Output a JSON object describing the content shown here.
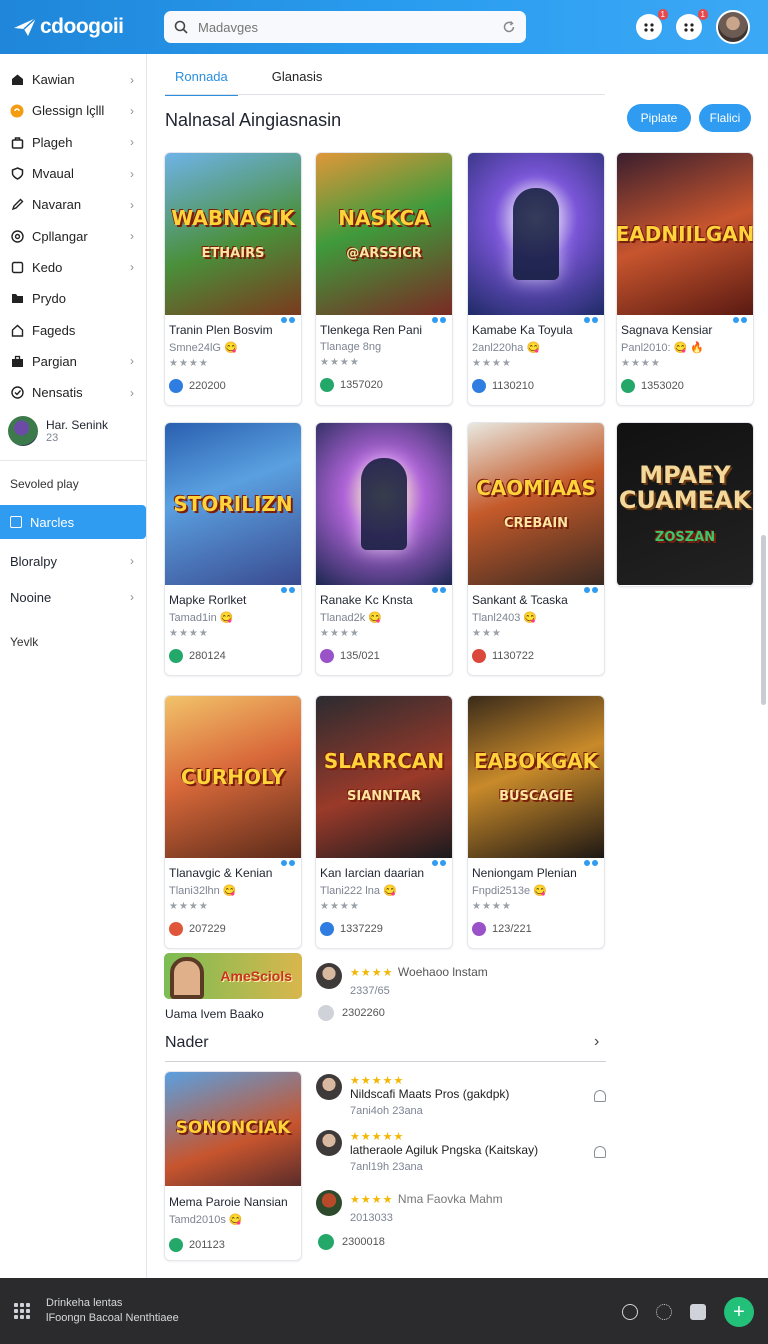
{
  "app": {
    "name": "cdoogoii"
  },
  "search": {
    "placeholder": "Madavges"
  },
  "notifications": {
    "badge1": "1",
    "badge2": "1"
  },
  "sidebar": {
    "items": [
      {
        "label": "Kawian",
        "icon": "home-icon",
        "chevron": true
      },
      {
        "label": "Glessign lçlll",
        "icon": "coin-icon",
        "chevron": true
      },
      {
        "label": "Plageh",
        "icon": "bag-icon",
        "chevron": true
      },
      {
        "label": "Mvaual",
        "icon": "shield-icon",
        "chevron": true
      },
      {
        "label": "Navaran",
        "icon": "pencil-icon",
        "chevron": true
      },
      {
        "label": "Cpllangar",
        "icon": "at-icon",
        "chevron": true
      },
      {
        "label": "Kedo",
        "icon": "square-icon",
        "chevron": true
      },
      {
        "label": "Prydo",
        "icon": "folder-icon",
        "chevron": false
      },
      {
        "label": "Fageds",
        "icon": "house-icon",
        "chevron": false
      },
      {
        "label": "Pargian",
        "icon": "briefcase-icon",
        "chevron": true
      },
      {
        "label": "Nensatis",
        "icon": "check-icon",
        "chevron": true
      }
    ],
    "user": {
      "name": "Har. Senink",
      "sub": "23"
    },
    "section_label": "Sevoled play",
    "active_item": "Narcles",
    "extra_items": [
      {
        "label": "Bloralpy",
        "chevron": true
      },
      {
        "label": "Nooine",
        "chevron": true
      }
    ],
    "footer_label": "Yevlk"
  },
  "main": {
    "tabs": [
      {
        "label": "Ronnada"
      },
      {
        "label": "Glanasis"
      }
    ],
    "title": "Nalnasal Aingiasnasin",
    "buttons": {
      "primary": "Piplate",
      "secondary": "Flalici"
    },
    "games": [
      {
        "title": "Tranin Plen Bosvim",
        "sub": "Smne24lG 😋",
        "stars": "★★★★",
        "count": "220200",
        "art": "WABNAGIK",
        "art_sub": "ETHAIRS",
        "accent": "#2f7de0"
      },
      {
        "title": "Tlenkega Ren Pani",
        "sub": "Tlanage 8ng",
        "stars": "★★★★",
        "count": "1357020",
        "art": "NASKCA",
        "art_sub": "@ARSSICR",
        "accent": "#24a86a"
      },
      {
        "title": "Kamabe Ka Toyula",
        "sub": "2anl220ha 😋",
        "stars": "★★★★",
        "count": "1130210",
        "art": "",
        "art_sub": "",
        "accent": "#2f7de0"
      },
      {
        "title": "Sagnava Kensiar",
        "sub": "Panl2010: 😋 🔥",
        "stars": "★★★★",
        "count": "1353020",
        "art": "EADNIILGAN",
        "art_sub": "",
        "accent": "#24a86a"
      },
      {
        "title": "Mapke Rorlket",
        "sub": "Tamad1in 😋",
        "stars": "★★★★",
        "count": "280124",
        "art": "STORILIZN",
        "art_sub": "",
        "accent": "#24a86a"
      },
      {
        "title": "Ranake Kc Knsta",
        "sub": "Tlanad2k 😋",
        "stars": "★★★★",
        "count": "135/021",
        "art": "",
        "art_sub": "",
        "accent": "#9a52c9"
      },
      {
        "title": "Sankant & Tcaska",
        "sub": "Tlanl2403 😋",
        "stars": "★★★",
        "count": "1130722",
        "art": "CAOMIAAS",
        "art_sub": "CREBAIN",
        "accent": "#d9483b"
      },
      {
        "title": "",
        "sub": "",
        "stars": "",
        "count": "",
        "art": "MPAEY CUAMEAK",
        "art_sub": "ZOSZAN",
        "accent": "#000000"
      },
      {
        "title": "Tlanavgic & Kenian",
        "sub": "Tlani32lhn 😋",
        "stars": "★★★★",
        "count": "207229",
        "art": "CURHOLY",
        "art_sub": "",
        "accent": "#e0563b"
      },
      {
        "title": "Kan Iarcian daarian",
        "sub": "Tlani222 lna 😋",
        "stars": "★★★★",
        "count": "1337229",
        "art": "SLARRCAN",
        "art_sub": "SIANNTAR",
        "accent": "#2f7de0"
      },
      {
        "title": "Neniongam Plenian",
        "sub": "Fnpdi2513e 😋",
        "stars": "★★★★",
        "count": "123/221",
        "art": "EABOKGAK",
        "art_sub": "BUSCAGIE",
        "accent": "#9a52c9"
      }
    ],
    "banner": {
      "text": "AmeSciols",
      "caption": "Uama Ivem Baako"
    },
    "review_top": {
      "stars": "★★★★",
      "name": "Woehaoo lnstam",
      "sub": "2337/65",
      "count": "2302260"
    },
    "section2": {
      "title": "Nader"
    },
    "featured": {
      "title": "Mema Paroie Nansian",
      "sub": "Tamd2010s 😋",
      "count": "201123",
      "art": "SONONCIAK"
    },
    "reviews": [
      {
        "stars": "★★★★★",
        "name": "Nildscafi Maats Pros (gakdpk)",
        "sub": "7ani4oh 23ana"
      },
      {
        "stars": "★★★★★",
        "name": "latheraole Agiluk Pngska (Kaitskay)",
        "sub": "7anl19h 23ana"
      },
      {
        "stars": "★★★★",
        "name": "Nma Faovka Mahm",
        "sub": "2013033",
        "count": "2300018"
      }
    ]
  },
  "bottombar": {
    "line1": "Drinkeha lentas",
    "line2": "lFoongn Bacoal Nenthtiaee",
    "fab": "+"
  },
  "colors": {
    "accent": "#2f9cf1",
    "topbar": "#1f86d9",
    "bottombar": "#2b2b2e",
    "fab": "#23c07a"
  }
}
